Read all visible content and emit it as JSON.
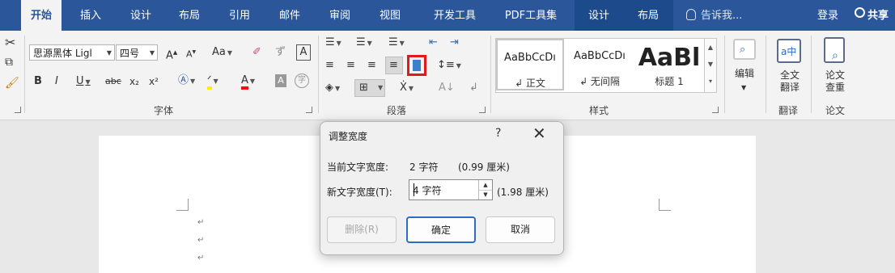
{
  "tabs": [
    "开始",
    "插入",
    "设计",
    "布局",
    "引用",
    "邮件",
    "审阅",
    "视图",
    "开发工具",
    "PDF工具集",
    "设计",
    "布局"
  ],
  "tell_me": "告诉我...",
  "login": "登录",
  "share": "共享",
  "font_group": {
    "font_name": "思源黑体 Ligl",
    "font_size": "四号",
    "label": "字体",
    "grow_font": "A",
    "shrink_font": "A",
    "change_case": "Aa",
    "bold": "B",
    "italic": "I",
    "underline": "U",
    "strikethrough": "abc",
    "subscript": "x₂",
    "superscript": "x²",
    "font_color": "A"
  },
  "paragraph_group": {
    "label": "段落"
  },
  "styles_group": {
    "label": "样式",
    "items": [
      {
        "preview": "AaBbCcDı",
        "name": "↲ 正文"
      },
      {
        "preview": "AaBbCcDı",
        "name": "↲ 无间隔"
      },
      {
        "preview": "AaBl",
        "name": "标题 1"
      }
    ]
  },
  "edit_group": {
    "label": "编辑"
  },
  "translate_group": {
    "button": "全文\n翻译",
    "label": "翻译"
  },
  "paper_group": {
    "button": "论文\n查重",
    "label": "论文"
  },
  "dialog": {
    "title": "调整宽度",
    "help": "?",
    "close": "✕",
    "current_label": "当前文字宽度:",
    "current_value": "2 字符",
    "current_cm": "(0.99 厘米)",
    "new_label": "新文字宽度(T):",
    "new_value": "4 字符",
    "new_cm": "(1.98 厘米)",
    "delete_button": "删除(R)",
    "ok_button": "确定",
    "cancel_button": "取消"
  },
  "document": {
    "paragraph_mark": "↵"
  }
}
